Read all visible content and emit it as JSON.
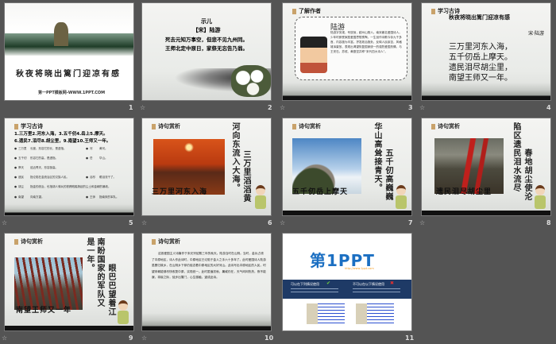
{
  "slides": [
    {
      "number": "1",
      "title": "秋夜将晓出篱门迎凉有感",
      "footer": "第一PPT模板网-WWW.1PPT.COM"
    },
    {
      "number": "2",
      "poem_title": "示儿",
      "author": "【宋】陆游",
      "lines": [
        "死去元知万事空，但悲不见九州同。",
        "王师北定中原日，家祭无忘告乃翁。"
      ]
    },
    {
      "number": "3",
      "header": "了解作者",
      "name": "陆游",
      "bio": "陆游字务观，号放翁，越州山阴人。南宋著名爱国诗人。少年时即受家庭爱国思想熏陶，一生创作诗歌今存九千多首，内容极为丰富。抒发政治抱负，反映人民疾苦，风格雄浑豪放，表现出渴望恢复国家统一的强烈爱国热情。与王安石、苏轼、黄庭坚并称“宋代四大诗人”。"
    },
    {
      "number": "4",
      "header": "学习古诗",
      "title": "秋夜将晓出篱门迎凉有感",
      "author": "宋·陆游",
      "lines": [
        "三万里河东入海，",
        "五千仞岳上摩天。",
        "遗民泪尽胡尘里，",
        "南望王师又一年。"
      ]
    },
    {
      "number": "5",
      "header": "学习古诗",
      "dictation": [
        "1.三万里2.河东入海，3.五千仞4.岳上5.摩天。",
        "6.遗民7.泪尽8.胡尘里，9.南望10.王师又一年。"
      ],
      "terms": [
        {
          "term": "三万里",
          "def": "长度，形容它的长，是虚指。",
          "term2": "河",
          "def2": "黄河。"
        },
        {
          "term": "五千仞",
          "def": "形容它的高，是虚指。",
          "term2": "岳",
          "def2": "华山。"
        },
        {
          "term": "摩天",
          "def": "迫近青天，形容极高。",
          "term2": "",
          "def2": ""
        },
        {
          "term": "遗民",
          "def": "指沦陷在金统治区的汉族人民。",
          "term2": "泪尽",
          "def2": "眼泪流干了。"
        },
        {
          "term": "胡尘",
          "def": "指金的统治，也指胡人骑兵的铁蹄践踏扬起的尘土和金朝的暴政。",
          "term2": "",
          "def2": ""
        },
        {
          "term": "南望",
          "def": "向南方望。",
          "term2": "王师",
          "def2": "指南宋的军队。"
        }
      ]
    },
    {
      "number": "6",
      "header": "诗句赏析",
      "caption": "三万里河东入海",
      "col1": "三万里滔滔黄",
      "col2": "河向东流入大海。"
    },
    {
      "number": "7",
      "header": "诗句赏析",
      "caption": "五千仞岳上摩天",
      "col1": "五千仞高巍巍",
      "col2": "华山高耸接青天。"
    },
    {
      "number": "8",
      "header": "诗句赏析",
      "caption": "遗民泪尽胡尘里",
      "col1": "春地胡尘使沦",
      "col2": "陷区遗民泪水流尽"
    },
    {
      "number": "9",
      "header": "诗句赏析",
      "caption": "南望王师又一年",
      "col1": "眼巴巴望着江",
      "col2": "南盼国家的军队又",
      "col3": "是一年。"
    },
    {
      "number": "10",
      "header": "诗句赏析",
      "text": "这首爱国主义诗篇作于宋光宗绍熙三年的秋天。陆游当时在山阴。当时，金兵占领了中原地区，诗人作此诗时，中原地区已沦陷于金人之手六十多年了。此时爱国诗人陆游虽罢归故乡，在山阴乡下却仍惦念着中原地区的大好河山。此诗写出中原地区的人民，时望宋朝能够尽快收复中原，实现统一。此时虽值初秋，暑威仍在，天气闷闷热热，夜不能寐，将晓之际，徒步出篱门，心生感触，遂成此诗。"
    },
    {
      "number": "11",
      "logo": "第1PPT",
      "logo_url": "http://www.1ppt.com",
      "can_use": "可以在下列情况使用",
      "cannot_use": "不可以在以下情况使用"
    }
  ],
  "colors": {
    "background": "#545454",
    "logo_blue": "#1b6fc2",
    "logo_orange": "#f39a1e",
    "banner": "#1e3a66"
  }
}
